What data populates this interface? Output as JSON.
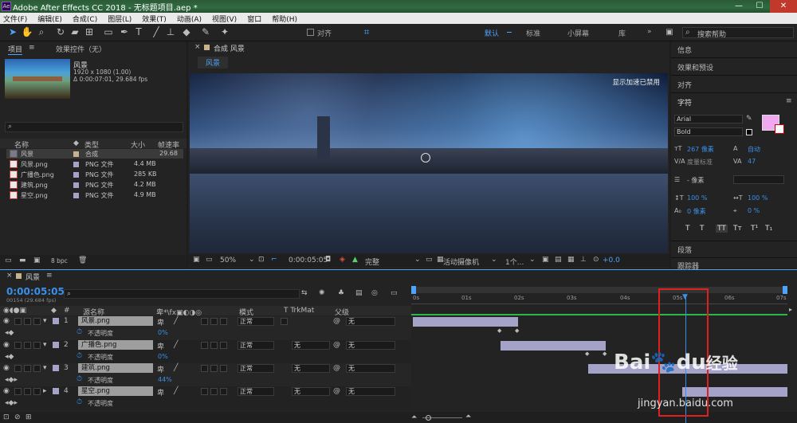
{
  "titlebar": {
    "app_icon": "Ae",
    "title": "Adobe After Effects CC 2018 - 无标题项目.aep *",
    "min": "—",
    "max": "☐",
    "close": "✕"
  },
  "menu": [
    "文件(F)",
    "编辑(E)",
    "合成(C)",
    "图层(L)",
    "效果(T)",
    "动画(A)",
    "视图(V)",
    "窗口",
    "帮助(H)"
  ],
  "toolbar": {
    "snap_label": "对齐",
    "workspaces": [
      "默认",
      "标准",
      "小屏幕",
      "库"
    ],
    "active_workspace": "默认",
    "more": "»",
    "search_placeholder": "搜索帮助"
  },
  "project": {
    "tab_project": "项目",
    "tab_effects": "效果控件（无）",
    "comp_name": "风景",
    "comp_res": "1920 x 1080 (1.00)",
    "comp_dur": "Δ 0:00:07:01, 29.684 fps",
    "search_placeholder": "",
    "col_name": "名称",
    "col_type": "类型",
    "col_size": "大小",
    "col_fps": "帧速率",
    "items": [
      {
        "name": "风景",
        "type": "合成",
        "size": "",
        "fps": "29.68"
      },
      {
        "name": "风景.png",
        "type": "PNG 文件",
        "size": "4.4 MB",
        "fps": ""
      },
      {
        "name": "广播色.png",
        "type": "PNG 文件",
        "size": "285 KB",
        "fps": ""
      },
      {
        "name": "建筑.png",
        "type": "PNG 文件",
        "size": "4.2 MB",
        "fps": ""
      },
      {
        "name": "星空.png",
        "type": "PNG 文件",
        "size": "4.9 MB",
        "fps": ""
      }
    ],
    "bpc": "8 bpc"
  },
  "composition": {
    "tab_label": "合成 风景",
    "sub_tab": "风景",
    "notice": "显示加速已禁用",
    "zoom": "50%",
    "timecode": "0:00:05:05",
    "resolution": "完整",
    "camera": "活动摄像机",
    "views": "1个...",
    "exposure": "+0.0"
  },
  "right_panel": {
    "sections": [
      "信息",
      "效果和预设",
      "对齐",
      "字符"
    ],
    "font": "Arial",
    "style": "Bold",
    "font_size": "267 像素",
    "leading": "自动",
    "kerning": "度量标准",
    "tracking": "47",
    "stroke": "- 像素",
    "vscale": "100 %",
    "hscale": "100 %",
    "baseline": "0 像素",
    "tsume": "0 %",
    "type_buttons": [
      "T",
      "T",
      "TT",
      "Tт",
      "T¹",
      "T₁"
    ],
    "paragraph": "段落",
    "tracker": "跟踪器"
  },
  "timeline": {
    "tab": "风景",
    "timecode": "0:00:05:05",
    "frame_info": "00154 (29.684 fps)",
    "col_source": "源名称",
    "col_mode": "模式",
    "col_trkmat": "T TrkMat",
    "col_parent": "父级",
    "ruler": [
      "0s",
      "01s",
      "02s",
      "03s",
      "04s",
      "05s",
      "06s",
      "07s"
    ],
    "layers": [
      {
        "num": "1",
        "name": "风景.png",
        "mode": "正常",
        "trkmat": "",
        "parent": "无",
        "prop": "不透明度",
        "prop_val": "0%"
      },
      {
        "num": "2",
        "name": "广播色.png",
        "mode": "正常",
        "trkmat": "无",
        "parent": "无",
        "prop": "不透明度",
        "prop_val": "0%"
      },
      {
        "num": "3",
        "name": "建筑.png",
        "mode": "正常",
        "trkmat": "无",
        "parent": "无",
        "prop": "不透明度",
        "prop_val": "44%"
      },
      {
        "num": "4",
        "name": "星空.png",
        "mode": "正常",
        "trkmat": "无",
        "parent": "无",
        "prop": "不透明度",
        "prop_val": ""
      }
    ],
    "highlight_color": "#e02020",
    "playhead_color": "#3a8fe8"
  },
  "watermark": {
    "brand": "Bai",
    "brand2": "du",
    "brand3": "经验",
    "url": "jingyan.baidu.com"
  }
}
